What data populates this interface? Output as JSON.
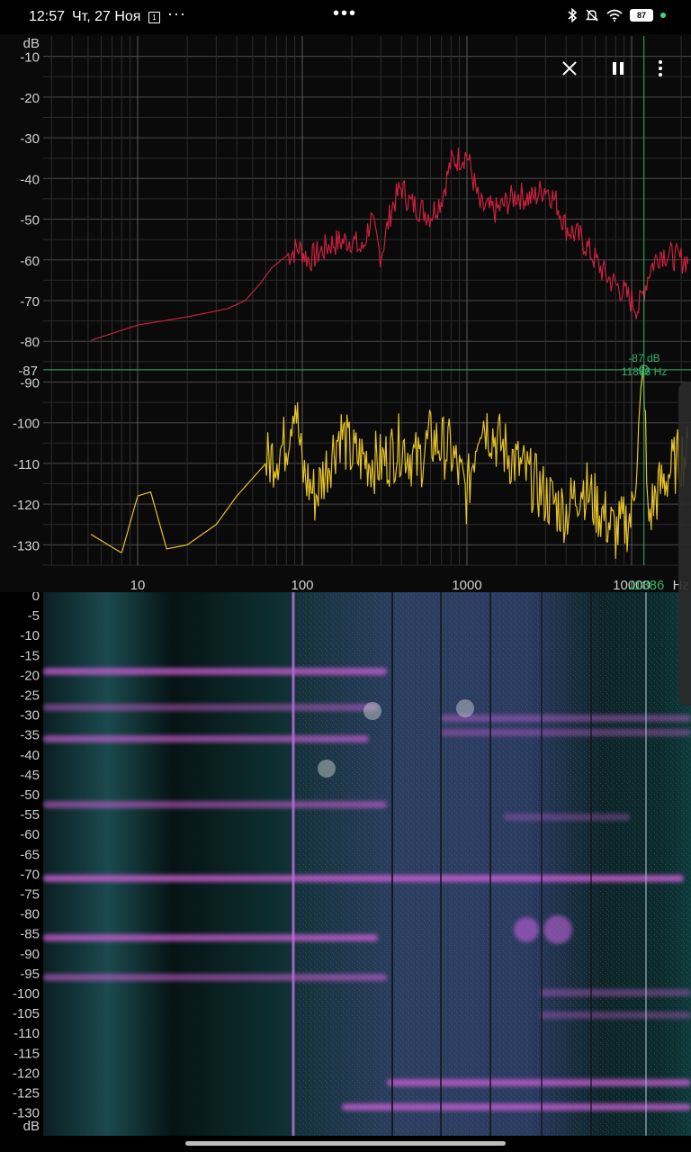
{
  "status": {
    "time": "12:57",
    "date": "Чт, 27 Ноя",
    "calendar_badge": "1",
    "overflow": "···",
    "center_menu": "•••",
    "battery": "87"
  },
  "toolbar": {
    "close_icon": "close-icon",
    "pause_icon": "pause-icon",
    "menu_icon": "more-vert-icon"
  },
  "spectrum": {
    "y_unit": "dB",
    "y_ticks": [
      "-10",
      "-20",
      "-30",
      "-40",
      "-50",
      "-60",
      "-70",
      "-80",
      "-90",
      "-100",
      "-110",
      "-120",
      "-130"
    ],
    "x_ticks": [
      "10",
      "100",
      "1000",
      "10000"
    ],
    "x_unit": "Hz",
    "cursor_db_label": "-87",
    "cursor_readout_db": "-87 dB",
    "cursor_readout_hz": "11886 Hz",
    "cursor_hz_axis": "11886",
    "peak_series_color": "#c8203f",
    "live_series_color": "#e5c228",
    "cursor_color": "#2fb36a"
  },
  "spectrogram": {
    "y_ticks": [
      "0",
      "-5",
      "-10",
      "-15",
      "-20",
      "-25",
      "-30",
      "-35",
      "-40",
      "-45",
      "-50",
      "-55",
      "-60",
      "-65",
      "-70",
      "-75",
      "-80",
      "-85",
      "-90",
      "-95",
      "-100",
      "-105",
      "-110",
      "-115",
      "-120",
      "-125",
      "-130"
    ],
    "y_unit": "dB"
  }
}
